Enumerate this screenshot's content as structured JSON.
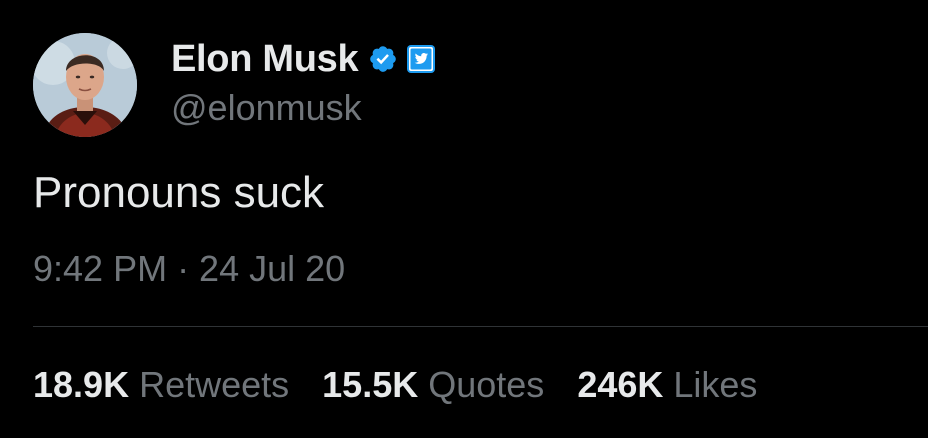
{
  "tweet": {
    "display_name": "Elon Musk",
    "handle": "@elonmusk",
    "text": "Pronouns suck",
    "timestamp": "9:42 PM · 24 Jul 20",
    "icons": {
      "verified": "verified-check-icon",
      "badge": "twitter-bird-icon"
    }
  },
  "stats": [
    {
      "count": "18.9K",
      "label": "Retweets"
    },
    {
      "count": "15.5K",
      "label": "Quotes"
    },
    {
      "count": "246K",
      "label": "Likes"
    }
  ],
  "colors": {
    "background": "#000000",
    "primary_text": "#e7e9ea",
    "secondary_text": "#71767b",
    "verified_blue": "#1d9bf0",
    "divider": "#2f3336"
  }
}
